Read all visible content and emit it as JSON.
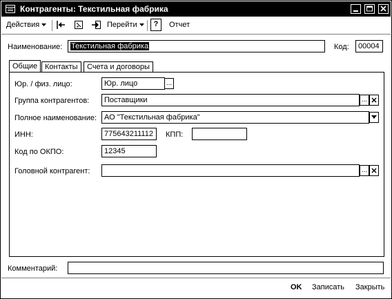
{
  "window": {
    "title": "Контрагенты: Текстильная фабрика"
  },
  "toolbar": {
    "actions_label": "Действия",
    "goto_label": "Перейти",
    "help_label": "?",
    "report_label": "Отчет"
  },
  "header": {
    "name_label": "Наименование:",
    "name_value": "Текстильная фабрика",
    "code_label": "Код:",
    "code_value": "00004"
  },
  "tabs": [
    {
      "label": "Общие",
      "active": true
    },
    {
      "label": "Контакты",
      "active": false
    },
    {
      "label": "Счета и договоры",
      "active": false
    }
  ],
  "general": {
    "entity_type_label": "Юр. / физ. лицо:",
    "entity_type_value": "Юр. лицо",
    "group_label": "Группа контрагентов:",
    "group_value": "Поставщики",
    "full_name_label": "Полное наименование:",
    "full_name_value": "АО \"Текстильная фабрика\"",
    "inn_label": "ИНН:",
    "inn_value": "775643211112",
    "kpp_label": "КПП:",
    "kpp_value": "",
    "okpo_label": "Код по ОКПО:",
    "okpo_value": "12345",
    "parent_label": "Головной контрагент:",
    "parent_value": ""
  },
  "comment": {
    "label": "Комментарий:",
    "value": ""
  },
  "footer": {
    "ok_label": "OK",
    "save_label": "Записать",
    "close_label": "Закрыть"
  },
  "icons": {
    "select": "ellipsis-icon",
    "clear": "close-icon",
    "dropdown": "chevron-down-icon"
  }
}
